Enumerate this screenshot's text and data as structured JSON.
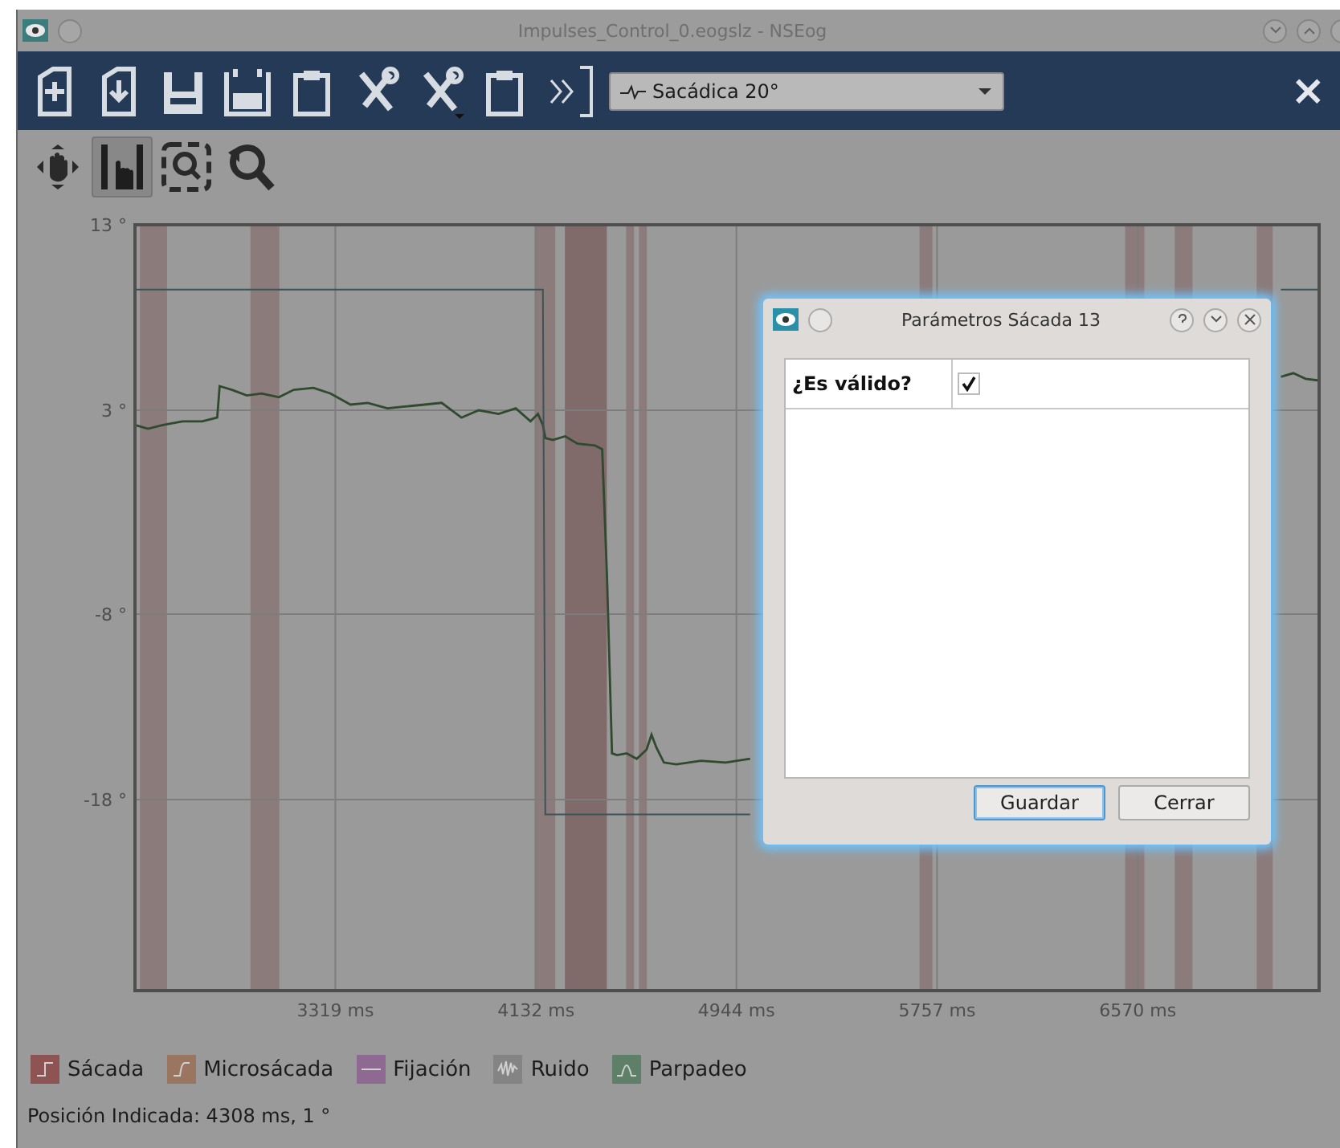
{
  "window": {
    "title": "Impulses_Control_0.eogslz - NSEog"
  },
  "toolbar": {
    "preset": {
      "value": "Sacádica 20°"
    },
    "close_symbol": "×"
  },
  "view_tools": [
    {
      "selected": false
    },
    {
      "selected": true
    },
    {
      "selected": false
    },
    {
      "selected": false
    }
  ],
  "plot": {
    "chart_data": {
      "type": "line",
      "x": [
        2507,
        2560,
        2620,
        2700,
        2780,
        2840,
        2850,
        2900,
        2960,
        3020,
        3090,
        3150,
        3230,
        3300,
        3380,
        3450,
        3530,
        3600,
        3680,
        3750,
        3830,
        3900,
        3980,
        4050,
        4110,
        4140,
        4160,
        4170,
        4200,
        4250,
        4300,
        4370,
        4400,
        4420,
        4440,
        4460,
        4500,
        4540,
        4580,
        4600,
        4620,
        4650,
        4700,
        4800,
        4900,
        5000,
        5050,
        7100,
        7150,
        7200,
        7250,
        7305
      ],
      "series": [
        {
          "color": "#2f4a2f",
          "values": [
            2.2,
            2.0,
            2.2,
            2.4,
            2.4,
            2.6,
            4.3,
            4.1,
            3.8,
            3.9,
            3.7,
            4.1,
            4.2,
            3.9,
            3.3,
            3.4,
            3.1,
            3.2,
            3.3,
            3.4,
            2.6,
            3.0,
            2.8,
            3.1,
            2.4,
            2.8,
            2.2,
            1.5,
            1.4,
            1.6,
            1.2,
            1.1,
            0.9,
            -6,
            -15.5,
            -15.6,
            -15.5,
            -15.8,
            -15.3,
            -14.5,
            -15.2,
            -16.0,
            -16.1,
            -15.9,
            -16.0,
            -15.8,
            null,
            null,
            4.8,
            5.0,
            4.7,
            4.6
          ]
        },
        {
          "color": "#3c5457",
          "values": [
            9.5,
            9.5,
            9.5,
            9.5,
            9.5,
            9.5,
            9.5,
            9.5,
            9.5,
            9.5,
            9.5,
            9.5,
            9.5,
            9.5,
            9.5,
            9.5,
            9.5,
            9.5,
            9.5,
            9.5,
            9.5,
            9.5,
            9.5,
            9.5,
            9.5,
            9.5,
            9.5,
            -18.8,
            -18.8,
            -18.8,
            -18.8,
            -18.8,
            -18.8,
            -18.8,
            -18.8,
            -18.8,
            -18.8,
            -18.8,
            -18.8,
            -18.8,
            -18.8,
            -18.8,
            -18.8,
            -18.8,
            -18.8,
            -18.8,
            null,
            null,
            9.5,
            9.5,
            9.5,
            9.5
          ]
        }
      ],
      "grid": true,
      "xlim": [
        2507,
        7305
      ],
      "ylim": [
        -28.3,
        13
      ],
      "xticks": [
        {
          "value": 3319,
          "label": "3319 ms"
        },
        {
          "value": 4132,
          "label": "4132 ms"
        },
        {
          "value": 4944,
          "label": "4944 ms"
        },
        {
          "value": 5757,
          "label": "5757 ms"
        },
        {
          "value": 6570,
          "label": "6570 ms"
        }
      ],
      "yticks": [
        {
          "value": 13,
          "label": "13 °"
        },
        {
          "value": 3,
          "label": "3 °"
        },
        {
          "value": -8,
          "label": "-8 °"
        },
        {
          "value": -18,
          "label": "-18 °"
        }
      ],
      "bands": [
        {
          "axis": "x",
          "from": 2527,
          "to": 2637
        },
        {
          "axis": "x",
          "from": 2975,
          "to": 3092
        },
        {
          "axis": "x",
          "from": 4126,
          "to": 4210
        },
        {
          "axis": "x",
          "from": 4249,
          "to": 4419
        },
        {
          "axis": "x",
          "from": 4497,
          "to": 4529
        },
        {
          "axis": "x",
          "from": 4549,
          "to": 4581
        },
        {
          "axis": "x",
          "from": 5686,
          "to": 5738
        },
        {
          "axis": "x",
          "from": 6519,
          "to": 6597
        },
        {
          "axis": "x",
          "from": 6720,
          "to": 6792
        },
        {
          "axis": "x",
          "from": 7052,
          "to": 7117
        }
      ]
    }
  },
  "legend": [
    {
      "label": "Sácada",
      "color": "#8e5454"
    },
    {
      "label": "Microsácada",
      "color": "#9a7560"
    },
    {
      "label": "Fijación",
      "color": "#8e6a92"
    },
    {
      "label": "Ruido",
      "color": "#848484"
    },
    {
      "label": "Parpadeo",
      "color": "#5e8068"
    }
  ],
  "status_bar": {
    "text": "Posición Indicada: 4308 ms, 1 °"
  },
  "dialog": {
    "title": "Parámetros Sácada 13",
    "fields": [
      {
        "label": "¿Es válido?",
        "checked": true
      }
    ],
    "buttons": [
      {
        "label": "Guardar",
        "selected": true
      },
      {
        "label": "Cerrar",
        "selected": false
      }
    ]
  }
}
